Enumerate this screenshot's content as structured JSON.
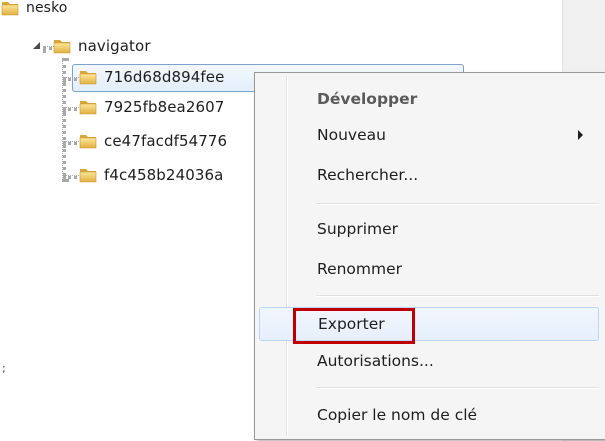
{
  "tree": {
    "parent_label": "nesko",
    "node_label": "navigator",
    "children": [
      {
        "label": "716d68d894fee"
      },
      {
        "label": "7925fb8ea2607"
      },
      {
        "label": "ce47facdf54776"
      },
      {
        "label": "f4c458b24036a"
      }
    ],
    "side_mark": ";"
  },
  "context_menu": {
    "items": [
      {
        "label": "Développer",
        "bold": true
      },
      {
        "label": "Nouveau",
        "has_submenu": true
      },
      {
        "label": "Rechercher..."
      },
      {
        "label": "Supprimer"
      },
      {
        "label": "Renommer"
      },
      {
        "label": "Exporter",
        "highlighted": true
      },
      {
        "label": "Autorisations..."
      },
      {
        "label": "Copier le nom de clé"
      }
    ]
  },
  "colors": {
    "highlight_box": "#c00000",
    "selection_border": "#7da2ce",
    "folder": "#e9c35a"
  }
}
